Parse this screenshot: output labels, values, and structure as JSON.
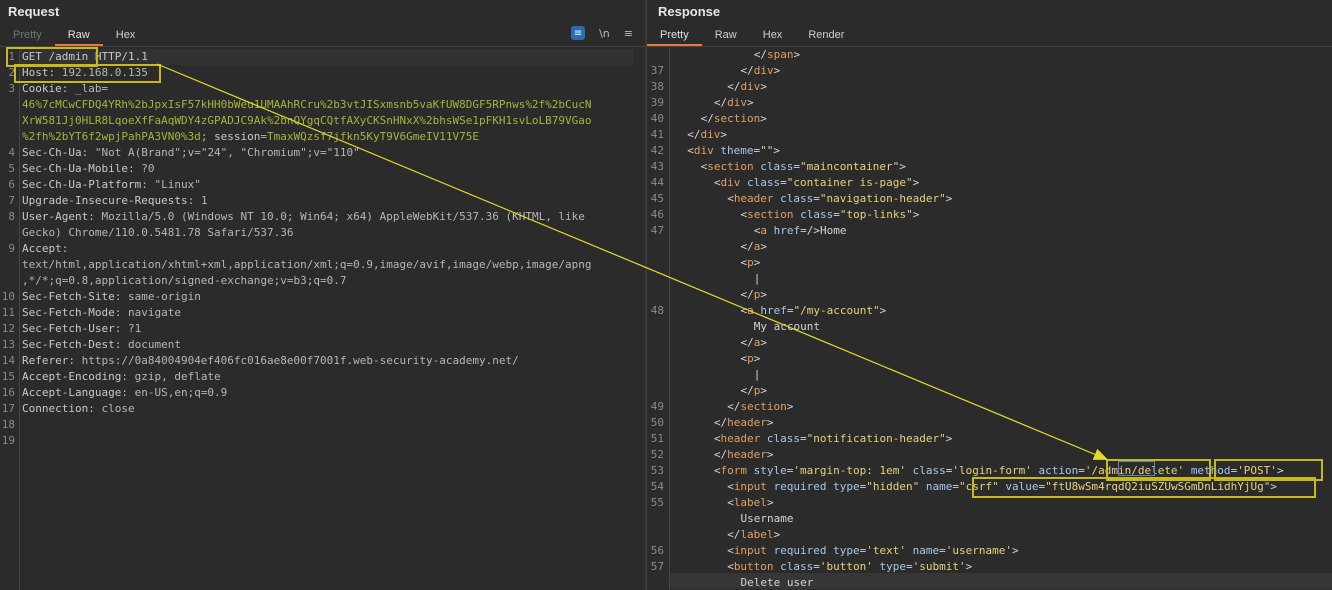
{
  "request": {
    "title": "Request",
    "tabs": [
      "Pretty",
      "Raw",
      "Hex"
    ],
    "active_tab": "Raw",
    "tools": {
      "wrap_icon": "wrap-lines-icon",
      "newline_label": "\\n",
      "menu_icon": "hamburger-menu-icon"
    },
    "lines": [
      {
        "n": "1",
        "parts": [
          [
            "k",
            "GET /admin HTTP/1.1"
          ]
        ]
      },
      {
        "n": "2",
        "parts": [
          [
            "k",
            "Host"
          ],
          [
            "v",
            ": 192.168.0.135"
          ]
        ]
      },
      {
        "n": "3",
        "parts": [
          [
            "k",
            "Cookie"
          ],
          [
            "v",
            ": _lab="
          ]
        ]
      },
      {
        "n": "",
        "parts": [
          [
            "ck",
            "46%7cMCwCFDQ4YRh%2bJpxIsF57kHH0bWeu1UMAAhRCru%2b3vtJISxmsnb5vaKfUW8DGF5RPnws%2f%2bCucN"
          ]
        ]
      },
      {
        "n": "",
        "parts": [
          [
            "ck",
            "XrW581Jj0HLR8LqoeXfFaAqWDY4zGPADJC9Ak%2bnQYgqCQtfAXyCKSnHNxX%2bhsWSe1pFKH1svLoLB79VGao"
          ]
        ]
      },
      {
        "n": "",
        "parts": [
          [
            "ck",
            "%2fh%2bYT6f2wpjPahPA3VN0%3d"
          ],
          [
            "v",
            "; "
          ],
          [
            "k",
            "session"
          ],
          [
            "v",
            "="
          ],
          [
            "ck",
            "TmaxWQzsf7jfkn5KyT9V6GmeIV11V75E"
          ]
        ]
      },
      {
        "n": "4",
        "parts": [
          [
            "k",
            "Sec-Ch-Ua"
          ],
          [
            "v",
            ": \"Not A(Brand\";v=\"24\", \"Chromium\";v=\"110\""
          ]
        ]
      },
      {
        "n": "5",
        "parts": [
          [
            "k",
            "Sec-Ch-Ua-Mobile"
          ],
          [
            "v",
            ": ?0"
          ]
        ]
      },
      {
        "n": "6",
        "parts": [
          [
            "k",
            "Sec-Ch-Ua-Platform"
          ],
          [
            "v",
            ": \"Linux\""
          ]
        ]
      },
      {
        "n": "7",
        "parts": [
          [
            "k",
            "Upgrade-Insecure-Requests"
          ],
          [
            "v",
            ": 1"
          ]
        ]
      },
      {
        "n": "8",
        "parts": [
          [
            "k",
            "User-Agent"
          ],
          [
            "v",
            ": Mozilla/5.0 (Windows NT 10.0; Win64; x64) AppleWebKit/537.36 (KHTML, like"
          ]
        ]
      },
      {
        "n": "",
        "parts": [
          [
            "v",
            "Gecko) Chrome/110.0.5481.78 Safari/537.36"
          ]
        ]
      },
      {
        "n": "9",
        "parts": [
          [
            "k",
            "Accept"
          ],
          [
            "v",
            ":"
          ]
        ]
      },
      {
        "n": "",
        "parts": [
          [
            "v",
            "text/html,application/xhtml+xml,application/xml;q=0.9,image/avif,image/webp,image/apng"
          ]
        ]
      },
      {
        "n": "",
        "parts": [
          [
            "v",
            ",*/*;q=0.8,application/signed-exchange;v=b3;q=0.7"
          ]
        ]
      },
      {
        "n": "10",
        "parts": [
          [
            "k",
            "Sec-Fetch-Site"
          ],
          [
            "v",
            ": same-origin"
          ]
        ]
      },
      {
        "n": "11",
        "parts": [
          [
            "k",
            "Sec-Fetch-Mode"
          ],
          [
            "v",
            ": navigate"
          ]
        ]
      },
      {
        "n": "12",
        "parts": [
          [
            "k",
            "Sec-Fetch-User"
          ],
          [
            "v",
            ": ?1"
          ]
        ]
      },
      {
        "n": "13",
        "parts": [
          [
            "k",
            "Sec-Fetch-Dest"
          ],
          [
            "v",
            ": document"
          ]
        ]
      },
      {
        "n": "14",
        "parts": [
          [
            "k",
            "Referer"
          ],
          [
            "v",
            ": https://0a84004904ef406fc016ae8e00f7001f.web-security-academy.net/"
          ]
        ]
      },
      {
        "n": "15",
        "parts": [
          [
            "k",
            "Accept-Encoding"
          ],
          [
            "v",
            ": gzip, deflate"
          ]
        ]
      },
      {
        "n": "16",
        "parts": [
          [
            "k",
            "Accept-Language"
          ],
          [
            "v",
            ": en-US,en;q=0.9"
          ]
        ]
      },
      {
        "n": "17",
        "parts": [
          [
            "k",
            "Connection"
          ],
          [
            "v",
            ": close"
          ]
        ]
      },
      {
        "n": "18",
        "parts": []
      },
      {
        "n": "19",
        "parts": []
      }
    ]
  },
  "response": {
    "title": "Response",
    "tabs": [
      "Pretty",
      "Raw",
      "Hex",
      "Render"
    ],
    "active_tab": "Pretty",
    "lines": [
      {
        "n": "",
        "indent": 12,
        "parts": [
          [
            "tag",
            "</"
          ],
          [
            "tagn",
            "span"
          ],
          [
            "tag",
            ">"
          ]
        ]
      },
      {
        "n": "37",
        "indent": 10,
        "parts": [
          [
            "tag",
            "</"
          ],
          [
            "tagn",
            "div"
          ],
          [
            "tag",
            ">"
          ]
        ]
      },
      {
        "n": "38",
        "indent": 8,
        "parts": [
          [
            "tag",
            "</"
          ],
          [
            "tagn",
            "div"
          ],
          [
            "tag",
            ">"
          ]
        ]
      },
      {
        "n": "39",
        "indent": 6,
        "parts": [
          [
            "tag",
            "</"
          ],
          [
            "tagn",
            "div"
          ],
          [
            "tag",
            ">"
          ]
        ]
      },
      {
        "n": "40",
        "indent": 4,
        "parts": [
          [
            "tag",
            "</"
          ],
          [
            "tagn",
            "section"
          ],
          [
            "tag",
            ">"
          ]
        ]
      },
      {
        "n": "41",
        "indent": 2,
        "parts": [
          [
            "tag",
            "</"
          ],
          [
            "tagn",
            "div"
          ],
          [
            "tag",
            ">"
          ]
        ]
      },
      {
        "n": "42",
        "indent": 2,
        "parts": [
          [
            "tag",
            "<"
          ],
          [
            "tagn",
            "div "
          ],
          [
            "attr",
            "theme"
          ],
          [
            "tag",
            "="
          ],
          [
            "str",
            "\"\""
          ],
          [
            "tag",
            ">"
          ]
        ]
      },
      {
        "n": "43",
        "indent": 4,
        "parts": [
          [
            "tag",
            "<"
          ],
          [
            "tagn",
            "section "
          ],
          [
            "attr",
            "class"
          ],
          [
            "tag",
            "="
          ],
          [
            "str",
            "\"maincontainer\""
          ],
          [
            "tag",
            ">"
          ]
        ]
      },
      {
        "n": "44",
        "indent": 6,
        "parts": [
          [
            "tag",
            "<"
          ],
          [
            "tagn",
            "div "
          ],
          [
            "attr",
            "class"
          ],
          [
            "tag",
            "="
          ],
          [
            "str",
            "\"container is-page\""
          ],
          [
            "tag",
            ">"
          ]
        ]
      },
      {
        "n": "45",
        "indent": 8,
        "parts": [
          [
            "tag",
            "<"
          ],
          [
            "tagn",
            "header "
          ],
          [
            "attr",
            "class"
          ],
          [
            "tag",
            "="
          ],
          [
            "str",
            "\"navigation-header\""
          ],
          [
            "tag",
            ">"
          ]
        ]
      },
      {
        "n": "46",
        "indent": 10,
        "parts": [
          [
            "tag",
            "<"
          ],
          [
            "tagn",
            "section "
          ],
          [
            "attr",
            "class"
          ],
          [
            "tag",
            "="
          ],
          [
            "str",
            "\"top-links\""
          ],
          [
            "tag",
            ">"
          ]
        ]
      },
      {
        "n": "47",
        "indent": 12,
        "parts": [
          [
            "tag",
            "<"
          ],
          [
            "tagn",
            "a "
          ],
          [
            "attr",
            "href"
          ],
          [
            "tag",
            "=/>"
          ],
          [
            "txt",
            "Home"
          ]
        ]
      },
      {
        "n": "",
        "indent": 10,
        "parts": [
          [
            "tag",
            "</"
          ],
          [
            "tagn",
            "a"
          ],
          [
            "tag",
            ">"
          ]
        ]
      },
      {
        "n": "",
        "indent": 10,
        "parts": [
          [
            "tag",
            "<"
          ],
          [
            "tagn",
            "p"
          ],
          [
            "tag",
            ">"
          ]
        ]
      },
      {
        "n": "",
        "indent": 12,
        "parts": [
          [
            "txt",
            "|"
          ]
        ]
      },
      {
        "n": "",
        "indent": 10,
        "parts": [
          [
            "tag",
            "</"
          ],
          [
            "tagn",
            "p"
          ],
          [
            "tag",
            ">"
          ]
        ]
      },
      {
        "n": "48",
        "indent": 10,
        "parts": [
          [
            "tag",
            "<"
          ],
          [
            "tagn",
            "a "
          ],
          [
            "attr",
            "href"
          ],
          [
            "tag",
            "="
          ],
          [
            "str",
            "\"/my-account\""
          ],
          [
            "tag",
            ">"
          ]
        ]
      },
      {
        "n": "",
        "indent": 12,
        "parts": [
          [
            "txt",
            "My account"
          ]
        ]
      },
      {
        "n": "",
        "indent": 10,
        "parts": [
          [
            "tag",
            "</"
          ],
          [
            "tagn",
            "a"
          ],
          [
            "tag",
            ">"
          ]
        ]
      },
      {
        "n": "",
        "indent": 10,
        "parts": [
          [
            "tag",
            "<"
          ],
          [
            "tagn",
            "p"
          ],
          [
            "tag",
            ">"
          ]
        ]
      },
      {
        "n": "",
        "indent": 12,
        "parts": [
          [
            "txt",
            "|"
          ]
        ]
      },
      {
        "n": "",
        "indent": 10,
        "parts": [
          [
            "tag",
            "</"
          ],
          [
            "tagn",
            "p"
          ],
          [
            "tag",
            ">"
          ]
        ]
      },
      {
        "n": "49",
        "indent": 8,
        "parts": [
          [
            "tag",
            "</"
          ],
          [
            "tagn",
            "section"
          ],
          [
            "tag",
            ">"
          ]
        ]
      },
      {
        "n": "50",
        "indent": 6,
        "parts": [
          [
            "tag",
            "</"
          ],
          [
            "tagn",
            "header"
          ],
          [
            "tag",
            ">"
          ]
        ]
      },
      {
        "n": "51",
        "indent": 6,
        "parts": [
          [
            "tag",
            "<"
          ],
          [
            "tagn",
            "header "
          ],
          [
            "attr",
            "class"
          ],
          [
            "tag",
            "="
          ],
          [
            "str",
            "\"notification-header\""
          ],
          [
            "tag",
            ">"
          ]
        ]
      },
      {
        "n": "52",
        "indent": 6,
        "parts": [
          [
            "tag",
            "</"
          ],
          [
            "tagn",
            "header"
          ],
          [
            "tag",
            ">"
          ]
        ]
      },
      {
        "n": "53",
        "indent": 6,
        "parts": [
          [
            "tag",
            "<"
          ],
          [
            "tagn",
            "form "
          ],
          [
            "attr",
            "style"
          ],
          [
            "tag",
            "="
          ],
          [
            "str",
            "'margin-top: 1em'"
          ],
          [
            "tag",
            " "
          ],
          [
            "attr",
            "class"
          ],
          [
            "tag",
            "="
          ],
          [
            "str",
            "'login-form'"
          ],
          [
            "tag",
            " "
          ],
          [
            "attr",
            "action"
          ],
          [
            "tag",
            "="
          ],
          [
            "str",
            "'/admin/delete'"
          ],
          [
            "tag",
            " "
          ],
          [
            "attr",
            "method"
          ],
          [
            "tag",
            "="
          ],
          [
            "str",
            "'POST'"
          ],
          [
            "tag",
            ">"
          ]
        ]
      },
      {
        "n": "54",
        "indent": 8,
        "parts": [
          [
            "tag",
            "<"
          ],
          [
            "tagn",
            "input "
          ],
          [
            "attr",
            "required "
          ],
          [
            "attr",
            "type"
          ],
          [
            "tag",
            "="
          ],
          [
            "str",
            "\"hidden\""
          ],
          [
            "tag",
            " "
          ],
          [
            "attr",
            "name"
          ],
          [
            "tag",
            "="
          ],
          [
            "str",
            "\"csrf\""
          ],
          [
            "tag",
            " "
          ],
          [
            "attr",
            "value"
          ],
          [
            "tag",
            "="
          ],
          [
            "str",
            "\"ftU8wSm4rqdQ2iuSZUwSGmDnLidhYjUg\""
          ],
          [
            "tag",
            ">"
          ]
        ]
      },
      {
        "n": "55",
        "indent": 8,
        "parts": [
          [
            "tag",
            "<"
          ],
          [
            "tagn",
            "label"
          ],
          [
            "tag",
            ">"
          ]
        ]
      },
      {
        "n": "",
        "indent": 10,
        "parts": [
          [
            "txt",
            "Username"
          ]
        ]
      },
      {
        "n": "",
        "indent": 8,
        "parts": [
          [
            "tag",
            "</"
          ],
          [
            "tagn",
            "label"
          ],
          [
            "tag",
            ">"
          ]
        ]
      },
      {
        "n": "56",
        "indent": 8,
        "parts": [
          [
            "tag",
            "<"
          ],
          [
            "tagn",
            "input "
          ],
          [
            "attr",
            "required "
          ],
          [
            "attr",
            "type"
          ],
          [
            "tag",
            "="
          ],
          [
            "str",
            "'text'"
          ],
          [
            "tag",
            " "
          ],
          [
            "attr",
            "name"
          ],
          [
            "tag",
            "="
          ],
          [
            "str",
            "'username'"
          ],
          [
            "tag",
            ">"
          ]
        ]
      },
      {
        "n": "57",
        "indent": 8,
        "parts": [
          [
            "tag",
            "<"
          ],
          [
            "tagn",
            "button "
          ],
          [
            "attr",
            "class"
          ],
          [
            "tag",
            "="
          ],
          [
            "str",
            "'button'"
          ],
          [
            "tag",
            " "
          ],
          [
            "attr",
            "type"
          ],
          [
            "tag",
            "="
          ],
          [
            "str",
            "'submit'"
          ],
          [
            "tag",
            ">"
          ]
        ]
      },
      {
        "n": "",
        "indent": 10,
        "parts": [
          [
            "txt",
            "Delete user"
          ]
        ]
      }
    ]
  },
  "colors": {
    "accent": "#e8793a",
    "highlight_box": "#c9b81a",
    "arrow": "#e0dc2a",
    "panel_bg": "#2b2b2b"
  }
}
